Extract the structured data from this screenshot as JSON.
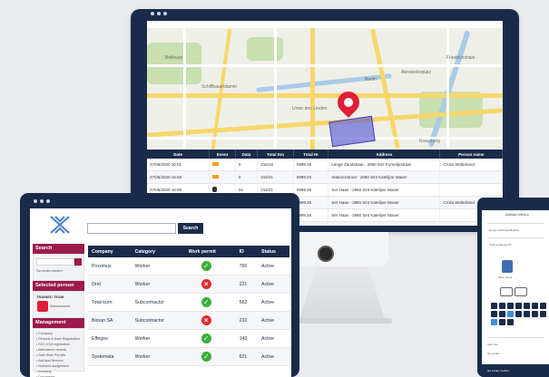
{
  "monitor": {
    "columns": [
      "Date",
      "Event",
      "Data",
      "Total Km",
      "Total Hr",
      "Address",
      "Person name"
    ],
    "rows": [
      {
        "date": "27/06/2020 16:01",
        "event": "truck",
        "data": "0",
        "km": "216/16",
        "hr": "0999:26",
        "address": "Lange Zandstraat - 2060 Sint Korneljestraat",
        "person": "Cross Wolterland"
      },
      {
        "date": "27/06/2020 16:08",
        "event": "truck",
        "data": "0",
        "km": "216/21",
        "hr": "0999:26",
        "address": "Stationsstraat - 2060 Sint Katelijne Waver",
        "person": ""
      },
      {
        "date": "27/06/2020 16:08",
        "event": "person",
        "data": "34",
        "km": "216/21",
        "hr": "0999:26",
        "address": "Ser Haas - 2860 Sint Katelijne Waver",
        "person": ""
      },
      {
        "date": "27/06/2020 16:08",
        "event": "fire",
        "data": "0",
        "km": "216/21",
        "hr": "0999:26",
        "address": "Ser Haas - 2860 Sint Katelijne Waver",
        "person": "Cross Wolterland"
      },
      {
        "date": "",
        "event": "",
        "data": "0",
        "km": "216/21",
        "hr": "0999:26",
        "address": "Ser Haas - 2860 Sint Katelijne Waver",
        "person": ""
      },
      {
        "date": "",
        "event": "",
        "data": "0",
        "km": "216/21",
        "hr": "",
        "address": "Ser Haas - 2860 Sint Katelijne Waver",
        "person": ""
      }
    ],
    "map_labels": [
      "Bellevue",
      "Schiffbauerdamm",
      "Unter den Linden",
      "Berlin",
      "Alexanderplatz",
      "Friedrichshain",
      "Kreuzberg"
    ]
  },
  "tablet": {
    "search_button": "Search",
    "sidebar": {
      "search_title": "Search",
      "search_note": "Ga verder zoeken",
      "person_title": "Selected person",
      "person_name": "TRAINED TEAM",
      "person_role": "Subcontractor",
      "management_title": "Management",
      "management_items": [
        "Company",
        "Persons & team Registration",
        "SCC-VCA registration",
        "Attendance records",
        "Safe Work Permits",
        "Add and Remove",
        "Selected assignment",
        "Invoicing",
        "Documents"
      ]
    },
    "columns": [
      "Company",
      "Category",
      "Work permit",
      "ID",
      "Status"
    ],
    "rows": [
      {
        "company": "Proximus",
        "category": "Worker",
        "permit": true,
        "id": "756",
        "status": "Active"
      },
      {
        "company": "Orid",
        "category": "Worker",
        "permit": false,
        "id": "221",
        "status": "Active"
      },
      {
        "company": "Total kurn",
        "category": "Subcontractor",
        "permit": true,
        "id": "562",
        "status": "Active"
      },
      {
        "company": "Bonan SA",
        "category": "Subcontractor",
        "permit": false,
        "id": "232",
        "status": "Active"
      },
      {
        "company": "Effegoo",
        "category": "Worker",
        "permit": true,
        "id": "143",
        "status": "Active"
      },
      {
        "company": "Systemata",
        "category": "Worker",
        "permit": true,
        "id": "621",
        "status": "Active"
      }
    ]
  },
  "phone": {
    "title": "Assistant check-in",
    "subtitle": "Group Card Identification",
    "rows": [
      "Scan employee ID",
      "Work hours",
      "Add note",
      "Ga verder"
    ],
    "footer": "Ga verder zoeken"
  },
  "colors": {
    "navy": "#1a2b4a",
    "accent": "#9c1a4c",
    "ok": "#3aae3a",
    "bad": "#e12d2d",
    "pin": "#e01e37"
  }
}
